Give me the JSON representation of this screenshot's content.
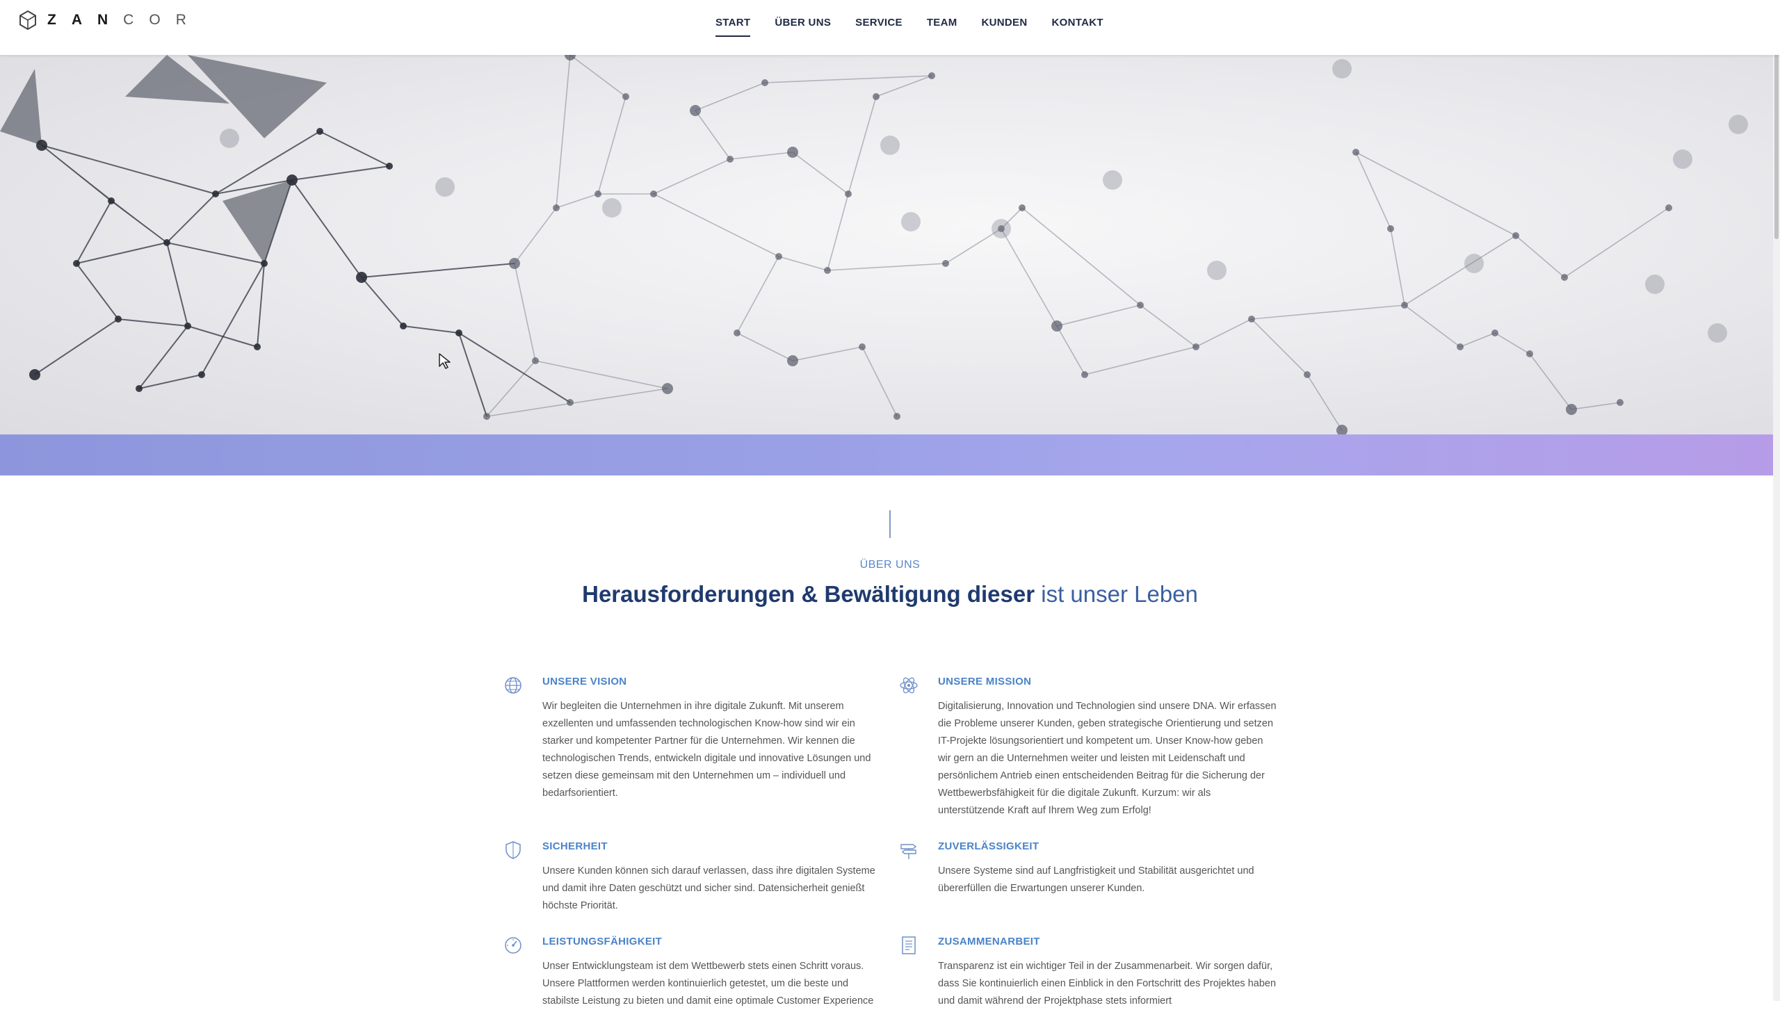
{
  "header": {
    "logo": {
      "bold": [
        "Z",
        "A",
        "N"
      ],
      "light": [
        "C",
        "O",
        "R"
      ]
    },
    "nav": [
      "START",
      "ÜBER UNS",
      "SERVICE",
      "TEAM",
      "KUNDEN",
      "KONTAKT"
    ],
    "active_nav": "START"
  },
  "about": {
    "eyebrow": "ÜBER UNS",
    "title_strong": "Herausforderungen & Bewältigung dieser",
    "title_light": "ist unser Leben"
  },
  "features": [
    {
      "icon": "globe-icon",
      "title": "UNSERE VISION",
      "text": "Wir begleiten die Unternehmen in ihre digitale Zukunft. Mit unserem exzellenten und umfassenden technologischen Know-how sind wir ein starker und kompetenter Partner für die Unternehmen. Wir kennen die technologischen Trends, entwickeln digitale und innovative Lösungen und setzen diese gemeinsam mit den Unternehmen um – individuell und bedarfsorientiert."
    },
    {
      "icon": "atom-icon",
      "title": "UNSERE MISSION",
      "text": "Digitalisierung, Innovation und Technologien sind unsere DNA. Wir erfassen die Probleme unserer Kunden, geben strategische Orientierung und setzen IT-Projekte lösungsorientiert und kompetent um. Unser Know-how geben wir gern an die Unternehmen weiter und leisten mit Leidenschaft und persönlichem Antrieb einen entscheidenden Beitrag für die Sicherung der Wettbewerbsfähigkeit für die digitale Zukunft. Kurzum: wir als unterstützende Kraft auf Ihrem Weg zum Erfolg!"
    },
    {
      "icon": "shield-icon",
      "title": "SICHERHEIT",
      "text": "Unsere Kunden können sich darauf verlassen, dass ihre digitalen Systeme und damit ihre Daten geschützt und sicher sind. Datensicherheit genießt höchste Priorität."
    },
    {
      "icon": "signpost-icon",
      "title": "ZUVERLÄSSIGKEIT",
      "text": "Unsere Systeme sind auf Langfristigkeit und Stabilität ausgerichtet und übererfüllen die Erwartungen unserer Kunden."
    },
    {
      "icon": "gauge-icon",
      "title": "LEISTUNGSFÄHIGKEIT",
      "text": "Unser Entwicklungsteam ist dem Wettbewerb stets einen Schritt voraus. Unsere Plattformen werden kontinuierlich getestet, um die beste und stabilste Leistung zu bieten und damit eine optimale Customer Experience"
    },
    {
      "icon": "document-icon",
      "title": "ZUSAMMENARBEIT",
      "text": "Transparenz ist ein wichtiger Teil in der Zusammenarbeit. Wir sorgen dafür, dass Sie kontinuierlich einen Einblick in den Fortschritt des Projektes haben und damit während der Projektphase stets informiert"
    }
  ]
}
